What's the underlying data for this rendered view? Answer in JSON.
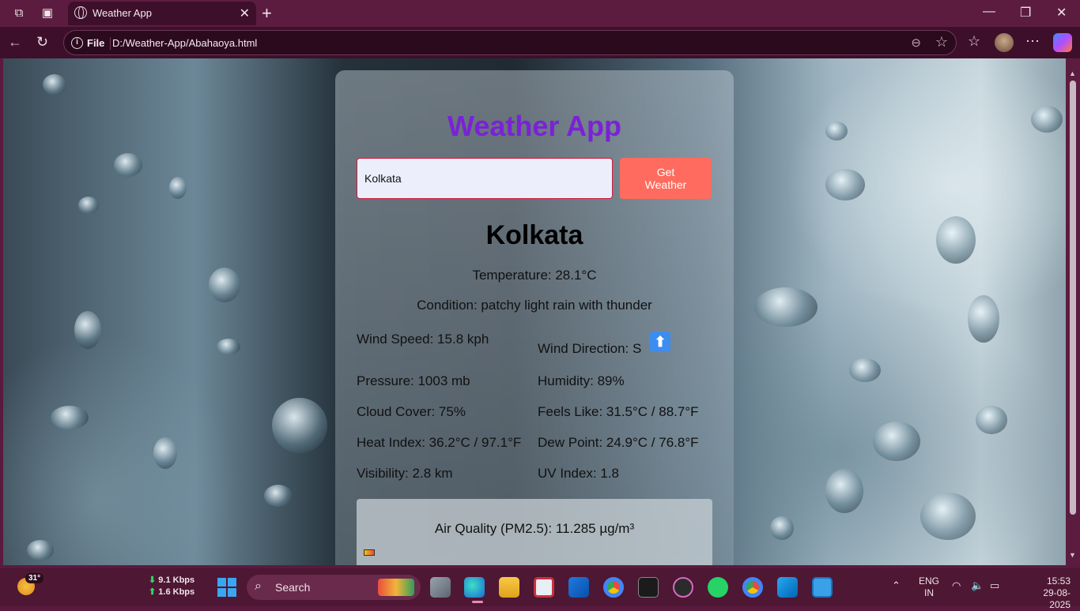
{
  "browser": {
    "tab_title": "Weather App",
    "address_label": "File",
    "url": "D:/Weather-App/Abahaoya.html"
  },
  "app": {
    "title": "Weather App",
    "input_value": "Kolkata",
    "button_label_1": "Get",
    "button_label_2": "Weather",
    "city": "Kolkata",
    "temperature": "Temperature: 28.1°C",
    "condition": "Condition: patchy light rain with thunder",
    "wind_speed": "Wind Speed: 15.8 kph",
    "wind_direction": "Wind Direction: S",
    "pressure": "Pressure: 1003 mb",
    "humidity": "Humidity: 89%",
    "cloud_cover": "Cloud Cover: 75%",
    "feels_like": "Feels Like: 31.5°C / 88.7°F",
    "heat_index": "Heat Index: 36.2°C / 97.1°F",
    "dew_point": "Dew Point: 24.9°C / 76.8°F",
    "visibility": "Visibility: 2.8 km",
    "uv_index": "UV Index: 1.8",
    "air_quality": "Air Quality (PM2.5): 11.285 µg/m³"
  },
  "taskbar": {
    "weather_temp": "31°",
    "net_down": "9.1 Kbps",
    "net_up": "1.6 Kbps",
    "search_label": "Search",
    "lang_1": "ENG",
    "lang_2": "IN",
    "time": "15:53",
    "date": "29-08-2025"
  },
  "colors": {
    "title": "#7a22d6",
    "button": "#ff6b5e",
    "wind_arrow": "#3d8cf0"
  }
}
